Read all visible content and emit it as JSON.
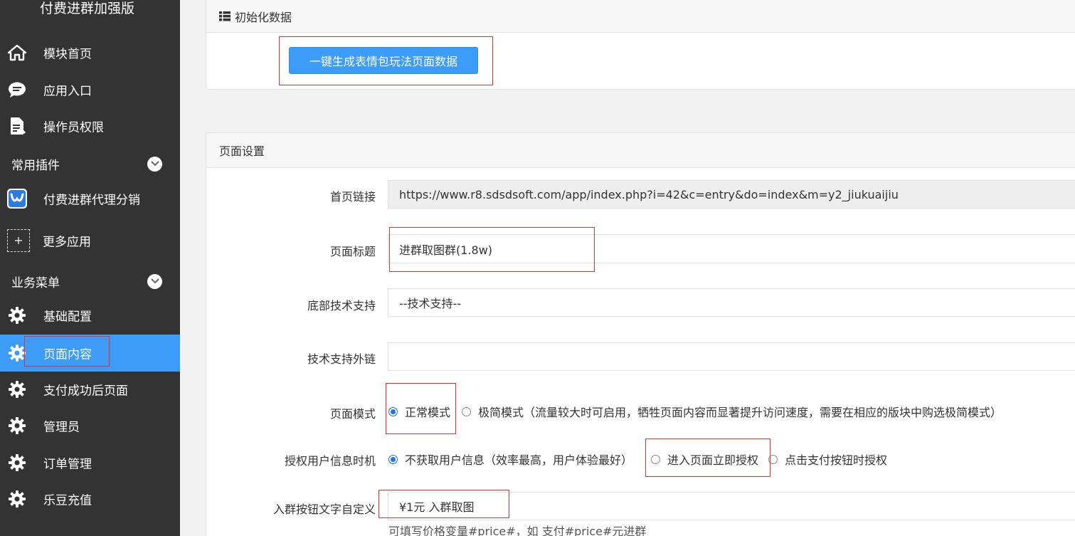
{
  "sidebar": {
    "title": "付费进群加强版",
    "items_top": [
      {
        "label": "模块首页",
        "icon": "home-icon"
      },
      {
        "label": "应用入口",
        "icon": "chat-icon"
      },
      {
        "label": "操作员权限",
        "icon": "document-icon"
      }
    ],
    "group1": "常用插件",
    "plugin_items": [
      {
        "label": "付费进群代理分销",
        "icon": "app-logo-icon"
      },
      {
        "label": "更多应用",
        "icon": "plus-icon"
      }
    ],
    "group2": "业务菜单",
    "business_items": [
      {
        "label": "基础配置",
        "icon": "gear-icon"
      },
      {
        "label": "页面内容",
        "icon": "gear-icon",
        "active": true
      },
      {
        "label": "支付成功后页面",
        "icon": "gear-icon"
      },
      {
        "label": "管理员",
        "icon": "gear-icon"
      },
      {
        "label": "订单管理",
        "icon": "gear-icon"
      },
      {
        "label": "乐豆充值",
        "icon": "gear-icon"
      }
    ]
  },
  "init_panel": {
    "title": "初始化数据",
    "button_label": "一键生成表情包玩法页面数据"
  },
  "page_settings": {
    "title": "页面设置",
    "home_link_label": "首页链接",
    "home_link_value": "https://www.r8.sdsdsoft.com/app/index.php?i=42&c=entry&do=index&m=y2_jiukuaijiu",
    "page_title_label": "页面标题",
    "page_title_value": "进群取图群(1.8w)",
    "footer_support_label": "底部技术支持",
    "footer_support_value": "--技术支持--",
    "support_link_label": "技术支持外链",
    "support_link_value": "",
    "page_mode_label": "页面模式",
    "page_mode_options": [
      "正常模式",
      "极简模式（流量较大时可启用，牺牲页面内容而显著提升访问速度，需要在相应的版块中购选极简模式）"
    ],
    "page_mode_selected": "正常模式",
    "auth_label": "授权用户信息时机",
    "auth_options": [
      "不获取用户信息（效率最高，用户体验最好）",
      "进入页面立即授权",
      "点击支付按钮时授权"
    ],
    "auth_selected": "不获取用户信息（效率最高，用户体验最好）",
    "join_button_label": "入群按钮文字自定义",
    "join_button_value": "¥1元 入群取图",
    "join_button_help": "可填写价格变量#price#，如 支付#price#元进群"
  },
  "colors": {
    "sidebar_bg": "#333333",
    "accent": "#3c9cf7",
    "annotation_red": "#e0322e"
  }
}
